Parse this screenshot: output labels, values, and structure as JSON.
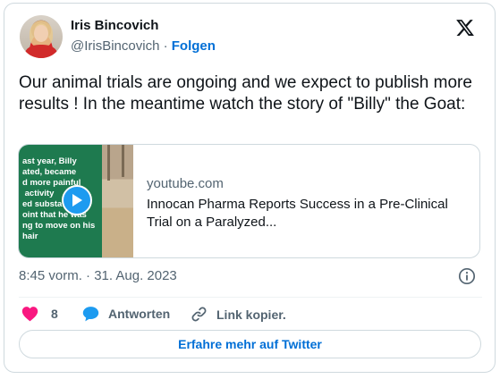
{
  "author": {
    "name": "Iris Bincovich",
    "handle": "@IrisBincovich",
    "separator": "·",
    "follow_label": "Folgen"
  },
  "tweet": {
    "text": "Our animal trials are ongoing and we expect to publish more results ! In the meantime watch the story of \"Billy\" the Goat:"
  },
  "link_card": {
    "domain": "youtube.com",
    "title": "Innocan Pharma Reports Success in a Pre-Clinical Trial on a Paralyzed...",
    "thumbnail_text": "ast year, Billy\nated, became\nd more painful\n activity\ned substan\noint that he was\nng to move on his\nhair"
  },
  "timestamp": "8:45 vorm. · 31. Aug. 2023",
  "actions": {
    "like_count": "8",
    "reply_label": "Antworten",
    "copy_link_label": "Link kopier."
  },
  "cta_label": "Erfahre mehr auf Twitter",
  "icons": {
    "x_logo": "x-logo-icon",
    "play": "play-icon",
    "info": "info-icon",
    "heart": "heart-icon",
    "reply": "speech-bubble-icon",
    "link": "link-icon"
  },
  "colors": {
    "like": "#f91880",
    "reply": "#1d9bf0",
    "link_text": "#006fd6",
    "secondary_text": "#536471",
    "thumbnail_green": "#1e7a4f"
  }
}
